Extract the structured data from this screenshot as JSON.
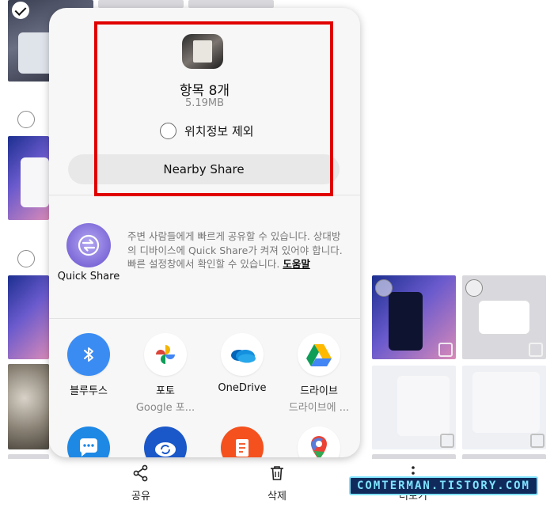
{
  "share_sheet": {
    "item_count": "항목 8개",
    "file_size": "5.19MB",
    "remove_location_label": "위치정보 제외",
    "nearby_share_label": "Nearby Share",
    "quick_share": {
      "label": "Quick Share",
      "description": "주변 사람들에게 빠르게 공유할 수 있습니다. 상대방의 디바이스에 Quick Share가 켜져 있어야 합니다. 빠른 설정창에서 확인할 수 있습니다.",
      "help_link": "도움말"
    },
    "apps": [
      {
        "name": "블루투스",
        "sub": "",
        "icon": "bluetooth-icon"
      },
      {
        "name": "포토",
        "sub": "Google 포...",
        "icon": "google-photos-icon"
      },
      {
        "name": "OneDrive",
        "sub": "",
        "icon": "onedrive-icon"
      },
      {
        "name": "드라이브",
        "sub": "드라이브에 ...",
        "icon": "google-drive-icon"
      },
      {
        "name": "",
        "sub": "",
        "icon": "messages-icon"
      },
      {
        "name": "",
        "sub": "",
        "icon": "cloud-sync-icon"
      },
      {
        "name": "",
        "sub": "",
        "icon": "notes-icon"
      },
      {
        "name": "",
        "sub": "",
        "icon": "google-maps-icon"
      }
    ]
  },
  "bottom_bar": {
    "share_label": "공유",
    "delete_label": "삭제",
    "more_label": "더보기"
  },
  "watermark": "COMTERMAN.TISTORY.COM",
  "colors": {
    "highlight": "#e00000",
    "quick_share_purple": "#7e6ad8",
    "sheet_bg": "#f7f7f7"
  }
}
